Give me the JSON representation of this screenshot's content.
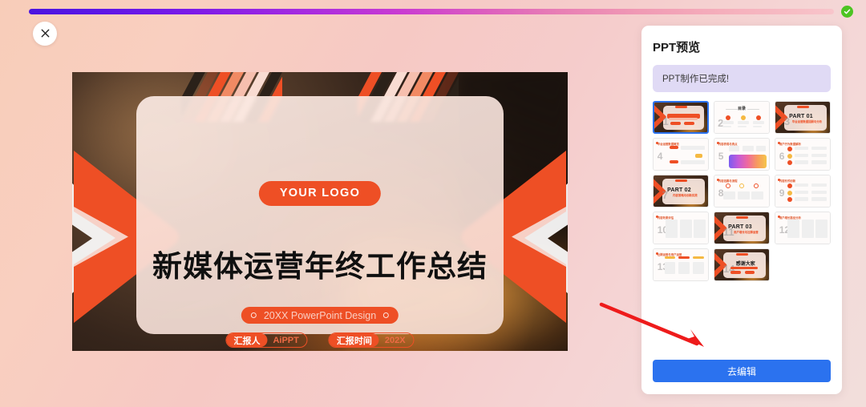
{
  "progress": {
    "percent": 100,
    "complete_icon": "check-circle-icon",
    "accent_start": "#4a14e0",
    "accent_end": "#f8c5cb",
    "check_color": "#4cc422"
  },
  "close_button": {
    "icon": "close-icon",
    "label": "×"
  },
  "slide": {
    "logo": "YOUR LOGO",
    "title": "新媒体运营年终工作总结",
    "subtitle": "20XX PowerPoint Design",
    "meta": [
      {
        "key": "汇报人",
        "value": "AiPPT"
      },
      {
        "key": "汇报时间",
        "value": "202X"
      }
    ],
    "accent": "#ee4f25"
  },
  "panel": {
    "title": "PPT预览",
    "status": "PPT制作已完成!",
    "status_bg": "#e0daf5",
    "edit_button": "去编辑",
    "edit_button_color": "#2b72ef",
    "selected_index": 1,
    "slides": [
      {
        "n": "1",
        "type": "cover",
        "title": "新媒体运营年终工作总结",
        "selected": true
      },
      {
        "n": "2",
        "type": "toc",
        "title": "目录"
      },
      {
        "n": "3",
        "type": "part",
        "part": "PART 01",
        "title": "平台运营数据回顾与分析"
      },
      {
        "n": "4",
        "type": "content",
        "title": "平台运营数据概览"
      },
      {
        "n": "5",
        "type": "content",
        "title": "内容表现与亮点"
      },
      {
        "n": "6",
        "type": "content",
        "title": "用户行为数据解析"
      },
      {
        "n": "7",
        "type": "part",
        "part": "PART 02",
        "title": "内容策略与创新实践"
      },
      {
        "n": "8",
        "type": "content",
        "title": "内容选题与流程"
      },
      {
        "n": "9",
        "type": "content",
        "title": "内容形式创新"
      },
      {
        "n": "10",
        "type": "content",
        "title": "内容效果评估"
      },
      {
        "n": "11",
        "type": "part",
        "part": "PART 03",
        "title": "用户增长与社群运营"
      },
      {
        "n": "12",
        "type": "content",
        "title": "用户增长路径分析"
      },
      {
        "n": "13",
        "type": "content",
        "title": "社群运营与用户运营"
      },
      {
        "n": "14",
        "type": "thanks",
        "title": "感谢大家"
      }
    ]
  },
  "annotation": {
    "arrow_color": "#ee1b1b",
    "points_to": "去编辑"
  }
}
